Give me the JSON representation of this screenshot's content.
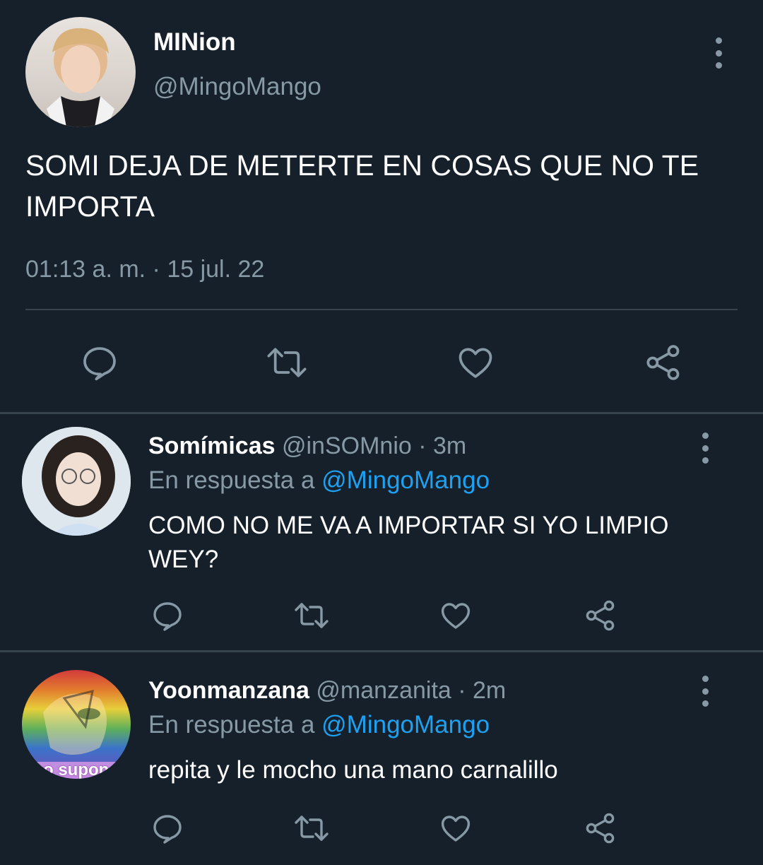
{
  "main_tweet": {
    "display_name": "MINion",
    "handle": "@MingoMango",
    "text": "SOMI DEJA DE METERTE EN COSAS QUE NO TE IMPORTA",
    "timestamp": "01:13 a. m. · 15 jul. 22"
  },
  "replies": [
    {
      "display_name": "Somímicas",
      "meta": "@inSOMnio · 3m",
      "in_reply_prefix": "En respuesta a ",
      "mention": "@MingoMango",
      "text": "COMO NO ME VA A IMPORTAR SI YO LIMPIO WEY?"
    },
    {
      "display_name": "Yoonmanzana",
      "meta": "@manzanita · 2m",
      "in_reply_prefix": "En respuesta a ",
      "mention": "@MingoMango",
      "text": "repita y le mocho una mano carnalillo",
      "avatar_caption": "o supon"
    }
  ],
  "colors": {
    "background": "#15202b",
    "secondary_text": "#8899a6",
    "link": "#1da1f2",
    "divider": "#38444d"
  }
}
